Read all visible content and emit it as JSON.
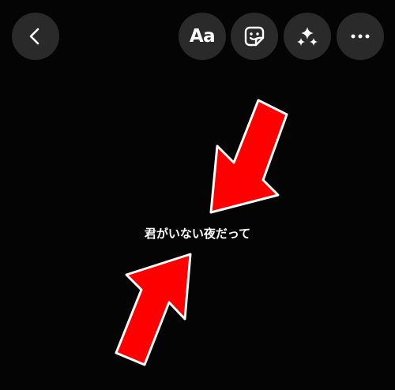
{
  "toolbar": {
    "back_icon": "chevron-left-icon",
    "text_tool_label": "Aa",
    "sticker_icon": "sticker-icon",
    "effects_icon": "sparkles-icon",
    "more_icon": "more-horizontal-icon"
  },
  "canvas": {
    "caption": "君がいない夜だって"
  },
  "annotations": {
    "arrow_color": "#ff0000",
    "arrow_outline": "#ffffff"
  }
}
